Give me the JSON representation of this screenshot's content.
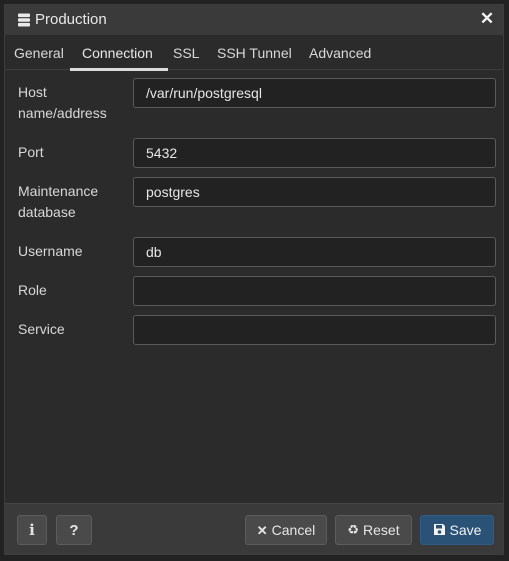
{
  "dialog": {
    "title": "Production",
    "close_symbol": "✕"
  },
  "tabs": [
    {
      "label": "General"
    },
    {
      "label": "Connection"
    },
    {
      "label": "SSL"
    },
    {
      "label": "SSH Tunnel"
    },
    {
      "label": "Advanced"
    }
  ],
  "active_tab": "Connection",
  "fields": {
    "host": {
      "label_line1": "Host",
      "label_line2": "name/address",
      "value": "/var/run/postgresql"
    },
    "port": {
      "label": "Port",
      "value": "5432"
    },
    "maintenance_db": {
      "label_line1": "Maintenance",
      "label_line2": "database",
      "value": "postgres"
    },
    "username": {
      "label": "Username",
      "value": "db"
    },
    "role": {
      "label": "Role",
      "value": ""
    },
    "service": {
      "label": "Service",
      "value": ""
    }
  },
  "footer": {
    "info_symbol": "i",
    "help_symbol": "?",
    "cancel_icon": "✕",
    "cancel_label": "Cancel",
    "reset_icon": "♻",
    "reset_label": "Reset",
    "save_label": "Save"
  },
  "icons": {
    "title": "database-icon",
    "close": "close-icon",
    "info": "info-icon",
    "help": "help-icon",
    "cancel": "close-icon",
    "reset": "recycle-icon",
    "save": "floppy-disk-icon"
  },
  "colors": {
    "background": "#2b2b2b",
    "titlebar": "#3a3a3a",
    "primary_button": "#2a5277"
  }
}
